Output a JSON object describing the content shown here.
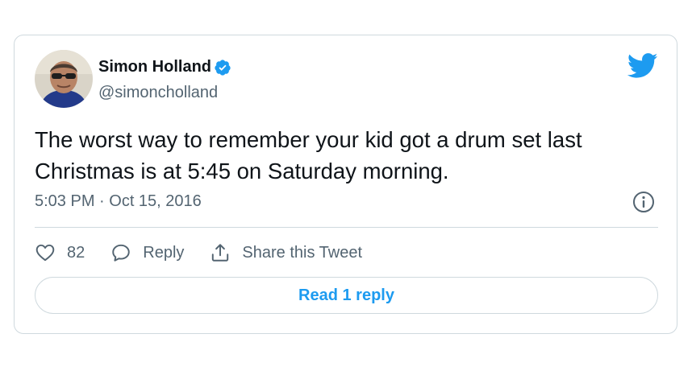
{
  "tweet": {
    "author": {
      "display_name": "Simon Holland",
      "handle": "@simoncholland",
      "verified": true
    },
    "text": "The worst way to remember your kid got a drum set last Christmas is at 5:45 on Saturday morning.",
    "timestamp": "5:03 PM · Oct 15, 2016",
    "actions": {
      "likes": "82",
      "reply_label": "Reply",
      "share_label": "Share this Tweet"
    },
    "read_replies_label": "Read 1 reply"
  },
  "colors": {
    "accent": "#1d9bf0",
    "text_primary": "#0f1419",
    "text_secondary": "#536471",
    "border": "#cfd9de"
  },
  "icons": [
    "verified-badge-icon",
    "twitter-bird-icon",
    "info-icon",
    "heart-icon",
    "reply-icon",
    "share-icon"
  ]
}
